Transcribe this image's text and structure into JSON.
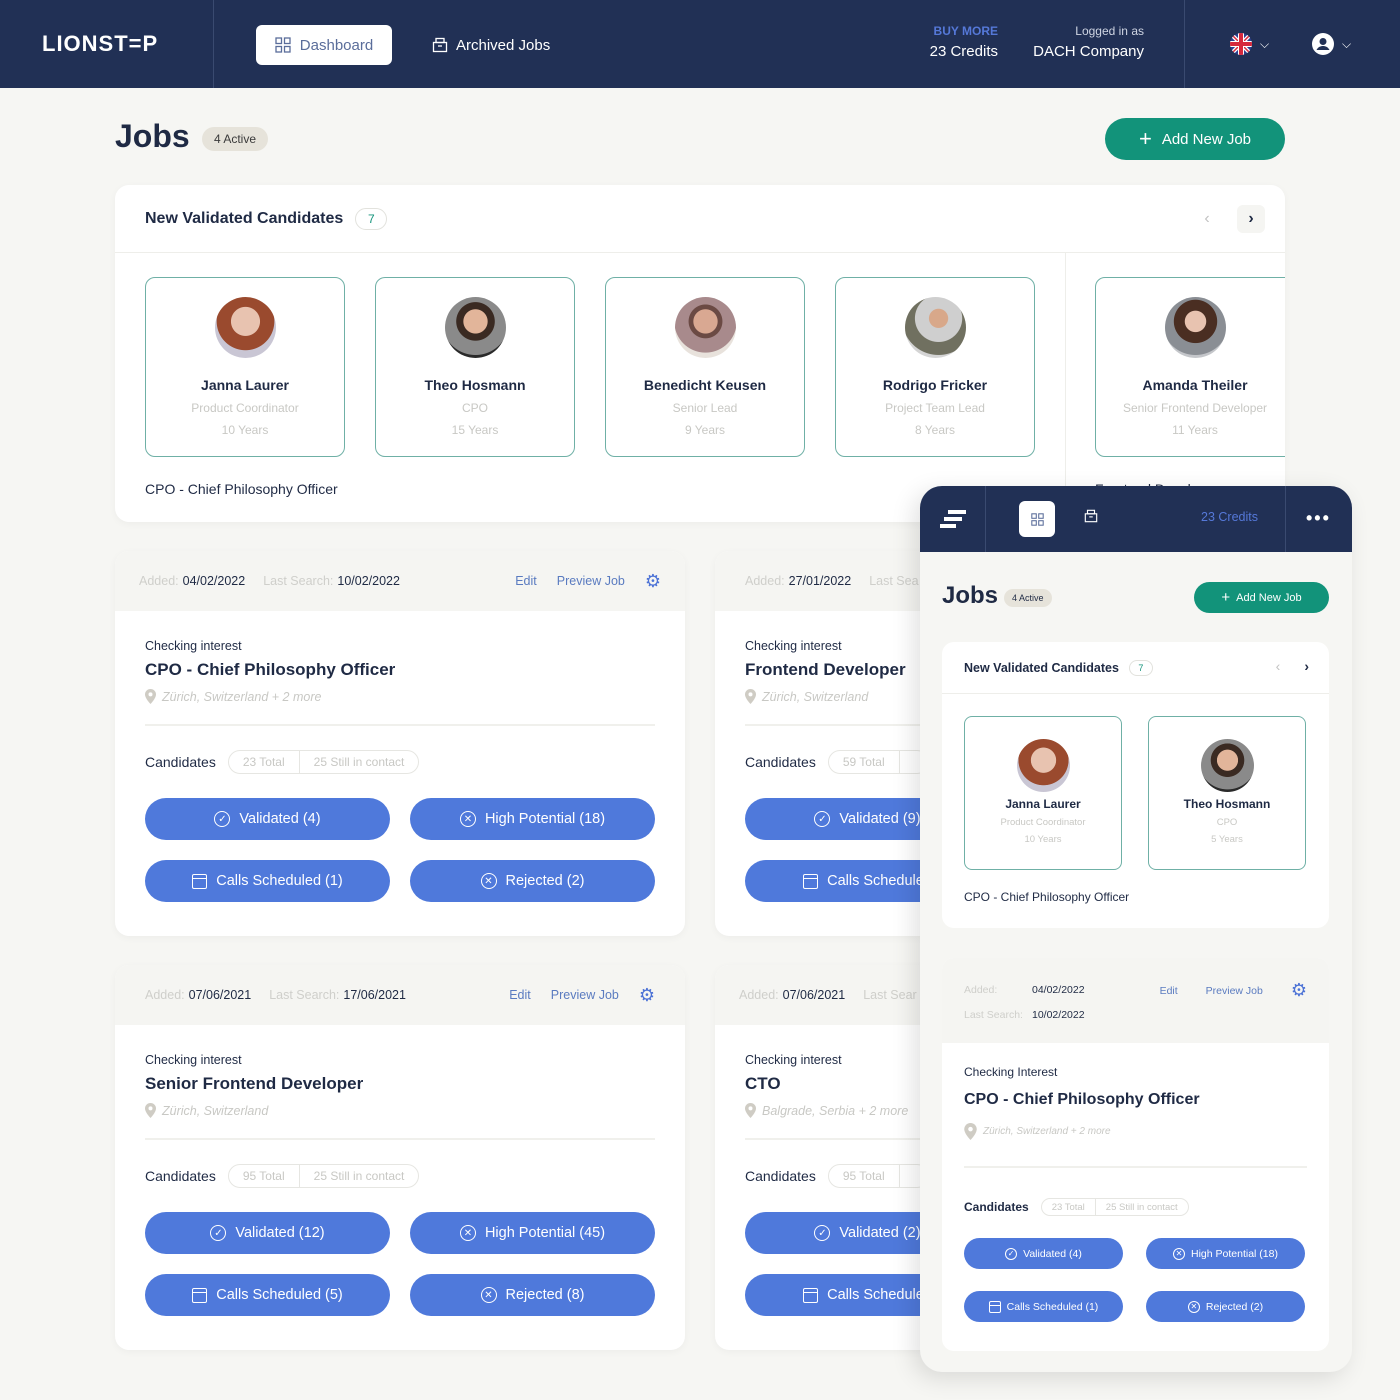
{
  "header": {
    "logo": "LIONST=P",
    "nav": [
      {
        "label": "Dashboard",
        "icon": "grid-icon",
        "active": true
      },
      {
        "label": "Archived Jobs",
        "icon": "archive-icon",
        "active": false
      }
    ],
    "buy_more": "BUY MORE",
    "credits": "23 Credits",
    "logged_in_label": "Logged in as",
    "company": "DACH Company",
    "language_icon": "uk-flag-icon",
    "user_icon": "user-icon"
  },
  "page": {
    "title": "Jobs",
    "active_badge": "4 Active",
    "add_button": "Add New Job"
  },
  "new_validated": {
    "title": "New Validated Candidates",
    "count": "7",
    "candidates": [
      {
        "name": "Janna Laurer",
        "role": "Product Coordinator",
        "years": "10 Years"
      },
      {
        "name": "Theo Hosmann",
        "role": "CPO",
        "years": "15 Years"
      },
      {
        "name": "Benedicht Keusen",
        "role": "Senior Lead",
        "years": "9 Years"
      },
      {
        "name": "Rodrigo Fricker",
        "role": "Project Team Lead",
        "years": "8 Years"
      },
      {
        "name": "Amanda Theiler",
        "role": "Senior Frontend Developer",
        "years": "11 Years"
      }
    ],
    "group_label_1": "CPO - Chief Philosophy Officer",
    "group_label_2": "Frontend Developer"
  },
  "jobs": [
    {
      "added_label": "Added:",
      "added": "04/02/2022",
      "last_search_label": "Last Search:",
      "last_search": "10/02/2022",
      "edit": "Edit",
      "preview": "Preview Job",
      "status": "Checking interest",
      "title": "CPO - Chief Philosophy Officer",
      "location": "Zürich, Switzerland + 2 more",
      "candidates_label": "Candidates",
      "total": "23 Total",
      "in_contact": "25 Still in contact",
      "validated": "Validated (4)",
      "high_potential": "High Potential (18)",
      "calls": "Calls Scheduled (1)",
      "rejected": "Rejected (2)"
    },
    {
      "added_label": "Added:",
      "added": "27/01/2022",
      "last_search_label": "Last Sea",
      "status": "Checking interest",
      "title": "Frontend Developer",
      "location": "Zürich, Switzerland",
      "candidates_label": "Candidates",
      "total": "59 Total",
      "validated": "Validated (9)",
      "calls": "Calls Scheduled"
    },
    {
      "added_label": "Added:",
      "added": "07/06/2021",
      "last_search_label": "Last Search:",
      "last_search": "17/06/2021",
      "edit": "Edit",
      "preview": "Preview Job",
      "status": "Checking interest",
      "title": "Senior Frontend Developer",
      "location": "Zürich, Switzerland",
      "candidates_label": "Candidates",
      "total": "95 Total",
      "in_contact": "25 Still in contact",
      "validated": "Validated (12)",
      "high_potential": "High Potential (45)",
      "calls": "Calls Scheduled (5)",
      "rejected": "Rejected (8)"
    },
    {
      "added_label": "Added:",
      "added": "07/06/2021",
      "last_search_label": "Last Sear",
      "status": "Checking interest",
      "title": "CTO",
      "location": "Balgrade, Serbia + 2 more",
      "candidates_label": "Candidates",
      "total": "95 Total",
      "validated": "Validated (2)",
      "calls": "Calls Scheduled"
    }
  ],
  "mobile": {
    "credits": "23 Credits",
    "title": "Jobs",
    "active_badge": "4 Active",
    "add_button": "Add New Job",
    "nvc_title": "New Validated Candidates",
    "nvc_count": "7",
    "candidates": [
      {
        "name": "Janna Laurer",
        "role": "Product Coordinator",
        "years": "10 Years"
      },
      {
        "name": "Theo Hosmann",
        "role": "CPO",
        "years": "5 Years"
      }
    ],
    "group_label": "CPO - Chief Philosophy Officer",
    "job": {
      "added_label": "Added:",
      "added": "04/02/2022",
      "last_search_label": "Last Search:",
      "last_search": "10/02/2022",
      "edit": "Edit",
      "preview": "Preview Job",
      "status": "Checking Interest",
      "title": "CPO - Chief Philosophy Officer",
      "location": "Zürich, Switzerland + 2 more",
      "candidates_label": "Candidates",
      "total": "23 Total",
      "in_contact": "25 Still in contact",
      "validated": "Validated (4)",
      "high_potential": "High Potential (18)",
      "calls": "Calls Scheduled (1)",
      "rejected": "Rejected (2)"
    }
  },
  "colors": {
    "navy": "#213055",
    "accent_green": "#12937a",
    "status_blue": "#4f79db",
    "link_blue": "#5a7bc0",
    "card_border": "#6fb0a6"
  }
}
